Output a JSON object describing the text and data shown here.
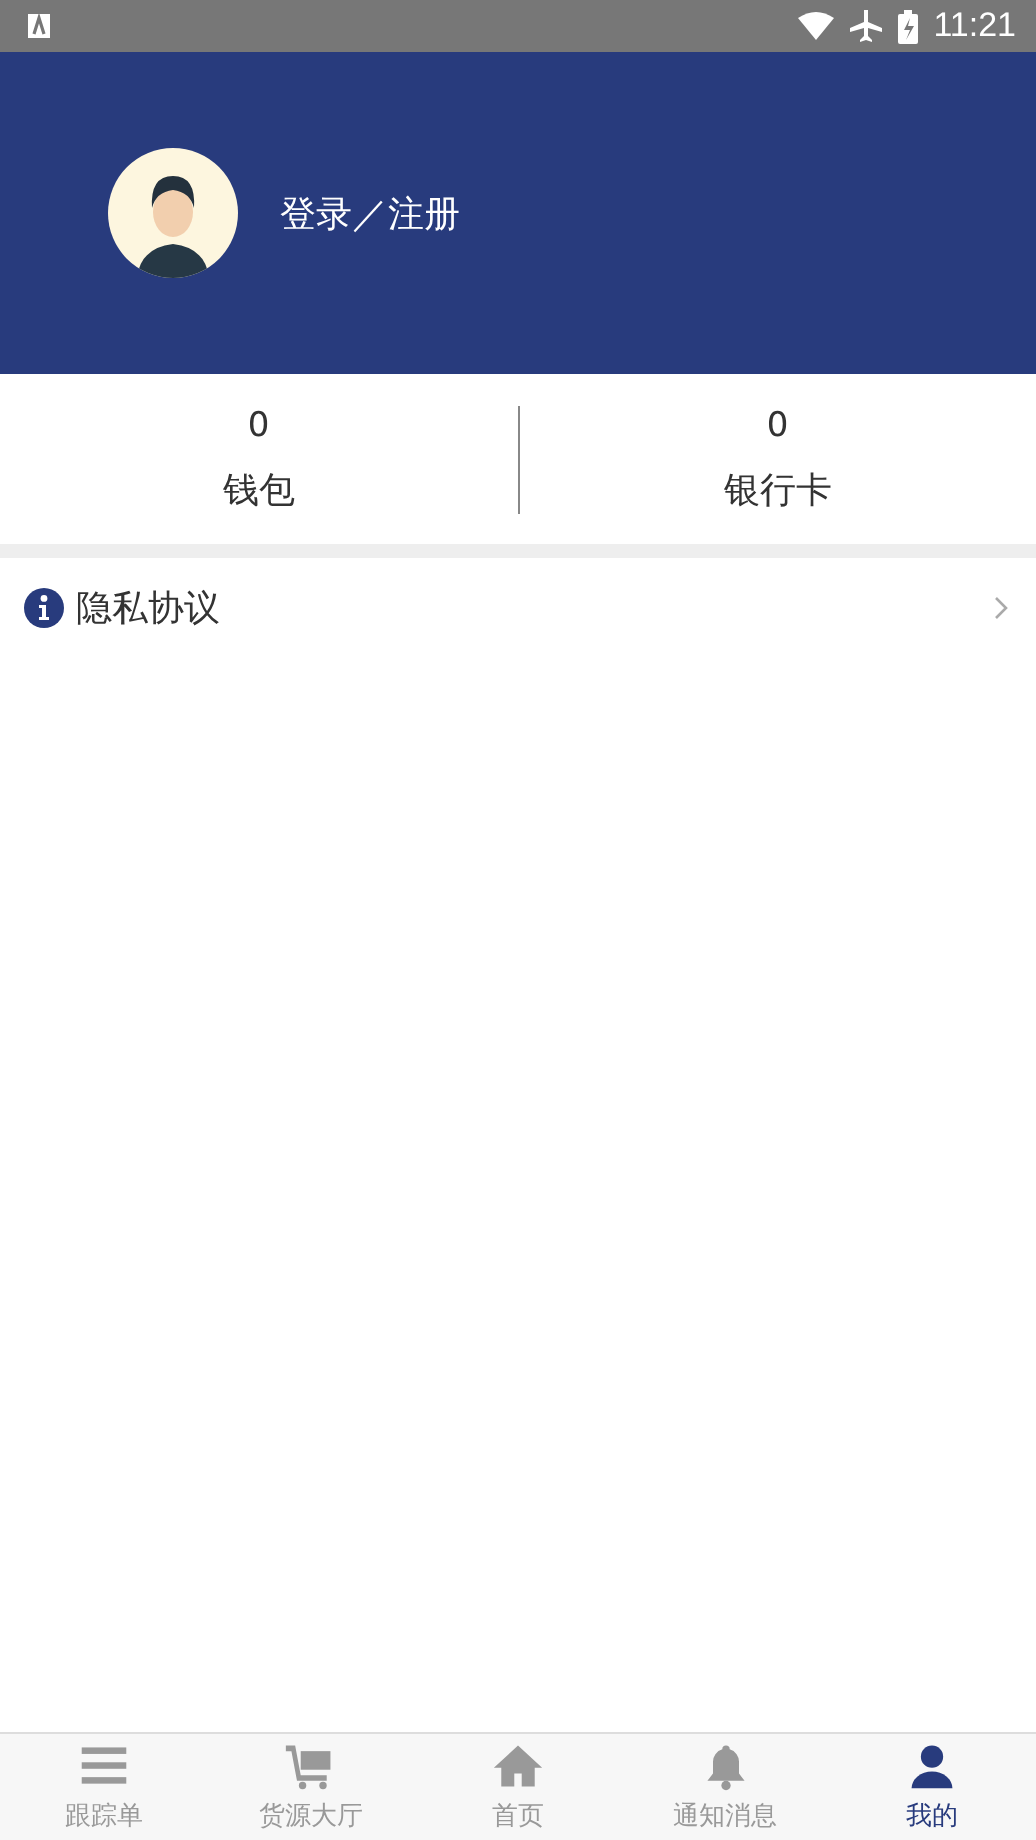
{
  "status_bar": {
    "time": "11:21"
  },
  "profile": {
    "login_label": "登录／注册"
  },
  "stats": [
    {
      "value": "0",
      "label": "钱包"
    },
    {
      "value": "0",
      "label": "银行卡"
    }
  ],
  "menu": [
    {
      "label": "隐私协议"
    }
  ],
  "tab_bar": [
    {
      "kind": "list",
      "label": "跟踪单",
      "selected": false
    },
    {
      "kind": "cart",
      "label": "货源大厅",
      "selected": false
    },
    {
      "kind": "home",
      "label": "首页",
      "selected": false
    },
    {
      "kind": "bell",
      "label": "通知消息",
      "selected": false
    },
    {
      "kind": "person",
      "label": "我的",
      "selected": true
    }
  ]
}
